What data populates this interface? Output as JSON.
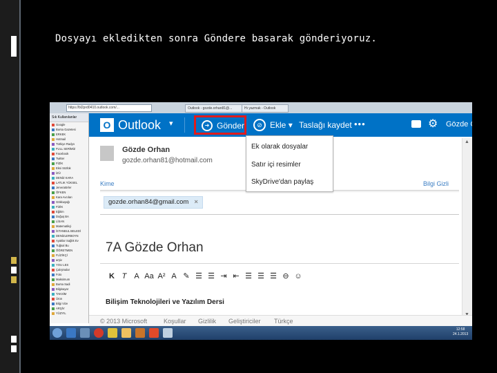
{
  "slide": {
    "title": "Dosyayı ekledikten sonra Göndere basarak gönderiyoruz."
  },
  "browser": {
    "address": "https://bl2prd0410.outlook.com/...",
    "tab1": "Outlook - gozde.orhan81@...",
    "tab2": "Hı yazmak - Outlook"
  },
  "favorites": {
    "header": "Sık Kullanılanlar",
    "items": [
      "Google",
      "Bursa Gazetesi",
      "ERKEK",
      "Hotmail",
      "Türkiye Radyo",
      "FULL SERİMİZ",
      "Facebook",
      "Twitter",
      "FİZİK",
      "Eksi Sözlük",
      "İZÜ",
      "DENİZ KARA",
      "LATLIK YÜKSEL",
      "Jeneratörler",
      "ÖFKEN",
      "Kara Avcıları",
      "Gökkuşağı",
      "FİZİK",
      "Eğitim",
      "Doğuş BA",
      "LİSAN",
      "Matematikçi",
      "İSTANBUL BELEDİ",
      "DENİZLERBOYN",
      "Ayaklar Sağlık Ev",
      "Tuğsal Bu",
      "ÖĞRETMEN",
      "FLİZİKÇİ",
      "arşiv",
      "YOU LES",
      "Çalışmalar",
      "Foto",
      "Maksimum",
      "Bursa Sadi",
      "Bilgisayar",
      "TAKSİM",
      "Ürün",
      "Bilgi Vize",
      "ARŞİV",
      "YÜZYIL"
    ]
  },
  "toolbar": {
    "logo_letter": "O",
    "logo": "Outlook",
    "send": "Gönder",
    "attach": "Ekle",
    "save_draft": "Taslağı kaydet",
    "more": "•••",
    "user": "Gözde O"
  },
  "attach_menu": {
    "items": [
      "Ek olarak dosyalar",
      "Satır içi resimler",
      "SkyDrive'dan paylaş"
    ]
  },
  "sender": {
    "name": "Gözde Orhan",
    "email": "gozde.orhan81@hotmail.com"
  },
  "compose": {
    "to_label": "Kime",
    "bcc_label": "Bilgi Gizli",
    "recipient": "gozde.orhan84@gmail.com",
    "remove": "×",
    "subject": "7A Gözde Orhan",
    "body": "Bilişim Teknolojileri ve Yazılım Dersi"
  },
  "format_bar": [
    "K",
    "T",
    "A",
    "Aa",
    "A²",
    "A",
    "✎",
    "☰",
    "☰",
    "⇥",
    "⇤",
    "☰",
    "☰",
    "☰",
    "⊖",
    "☺"
  ],
  "footer": {
    "copyright": "© 2013 Microsoft",
    "terms": "Koşullar",
    "privacy": "Gizlilik",
    "developers": "Geliştiriciler",
    "language": "Türkçe"
  },
  "clock": {
    "time": "12:58",
    "date": "24.1.2013"
  },
  "colors": {
    "outlook_blue": "#0072c6",
    "highlight": "#e21b1b"
  }
}
